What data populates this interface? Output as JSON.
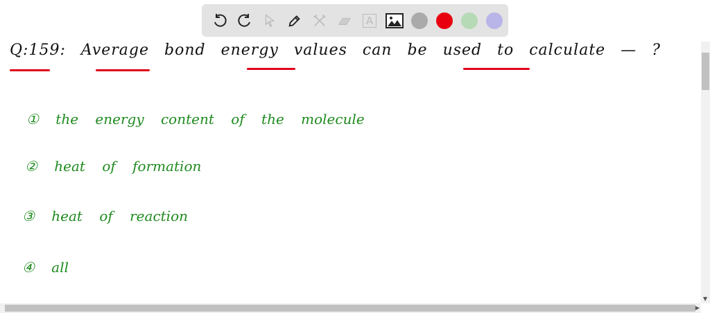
{
  "toolbar": {
    "tools": [
      "undo-icon",
      "redo-icon",
      "pointer-icon",
      "pen-icon",
      "tools-icon",
      "eraser-icon",
      "text-icon",
      "image-icon"
    ],
    "colors": [
      "#aaaaaa",
      "#e8000f",
      "#b6d9b6",
      "#b9b5e8"
    ],
    "text_tool_label": "A"
  },
  "question": {
    "text": "Q:159: Average bond energy values can be used to calculate — ?",
    "underline_color": "#e0001a"
  },
  "options": [
    {
      "text": "① the energy content of the molecule"
    },
    {
      "text": "② heat of formation"
    },
    {
      "text": "③ heat of reaction"
    },
    {
      "text": "④ all"
    }
  ],
  "ink_color": "#1f8a1f"
}
